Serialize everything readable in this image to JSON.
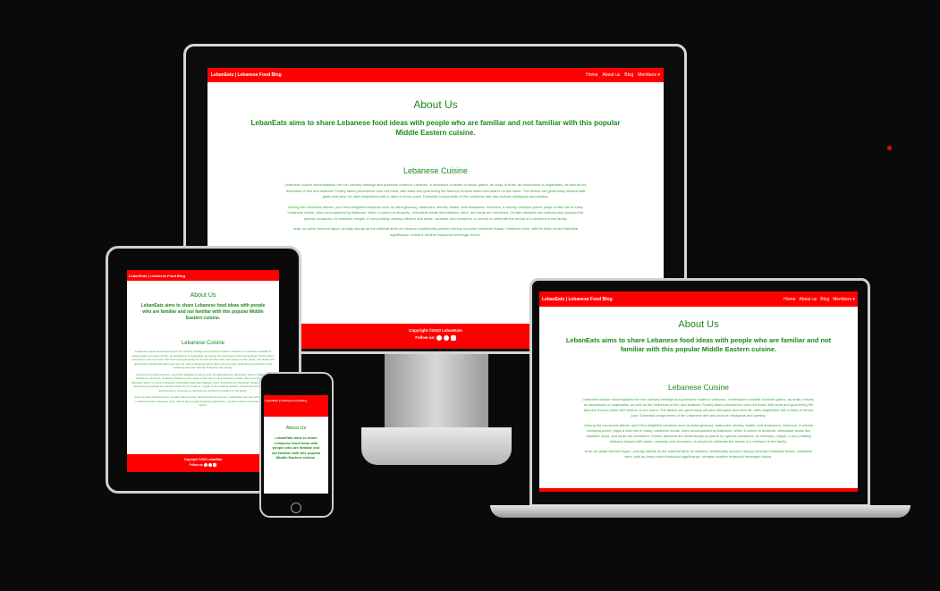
{
  "site": {
    "brand": "LebanEats | Lebanese Food Blog",
    "nav": [
      "Home",
      "About us",
      "Blog",
      "Members ▾"
    ],
    "about_title": "About Us",
    "lead": "LebanEats aims to share Lebanese food ideas with people who are familiar and not familiar with this popular Middle Eastern cuisine.",
    "section_title": "Lebanese Cuisine",
    "paragraphs": [
      "Lebanese cuisine encompasses the rich culinary heritage and practices rooted in Lebanon. It embraces a wealth of whole grains, an array of fruits, an abundance of vegetables, as well as the freshness of fish and seafood. Poultry takes precedence over red meat, with lamb and goat being the favored choices when red meat is on the menu. The dishes are generously infused with garlic and olive oil, often brightened with a dash of lemon juice. Essential components of the Lebanese diet also include chickpeas and parsley.",
      "Among the renowned dishes, you'll find delightful creations such as baba ghanouj, tabbouleh, sfeeha, falafel, and shawarma. Hummus, a velvety chickpea puree, plays a vital role in many Lebanese meals, often accompanied by flatbread. When it comes to desserts, delectable treats like baklawa, sfouf, and ka'ak are cherished. Certain desserts are meticulously prepared for special occasions; for instance, meghli, a rice pudding delicacy infused with anise, caraway, and cinnamon, is served to celebrate the arrival of a newborn in the family.",
      "Arak, an anise-flavored liquor, proudly stands as the national drink of Lebanon, traditionally savored during convivial Lebanese feasts. Lebanese wine, with its deep-rooted historical significance, remains another treasured beverage choice."
    ],
    "footer_copyright": "Copyright ©2023 LebanEats",
    "follow_label": "Follow us:",
    "social_icons": [
      "facebook-icon",
      "twitter-icon",
      "instagram-icon"
    ]
  },
  "colors": {
    "accent": "#ff0000",
    "text_green": "#1a8a1a",
    "background": "#0b0a0b"
  }
}
